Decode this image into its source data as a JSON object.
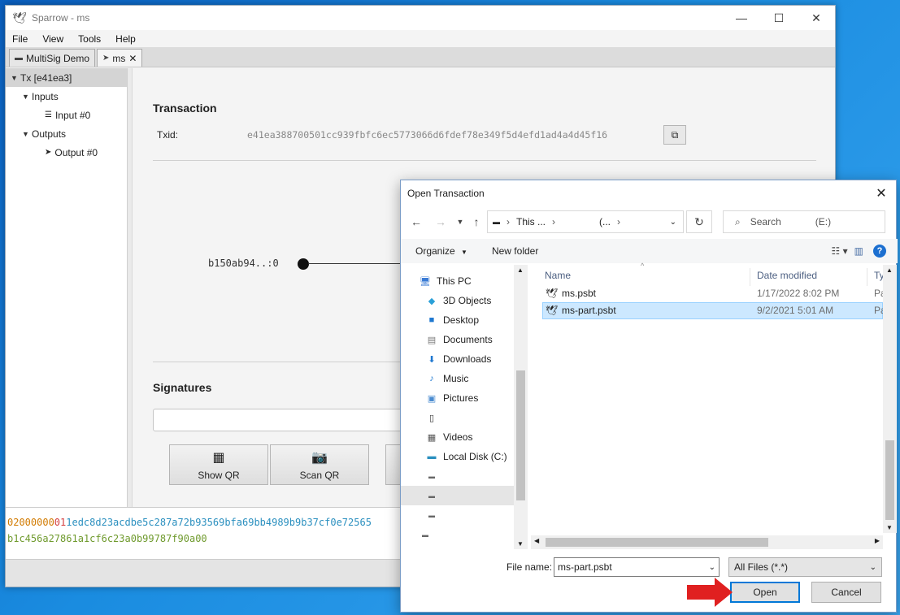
{
  "sparrow": {
    "title": "Sparrow - ms",
    "menu": [
      "File",
      "View",
      "Tools",
      "Help"
    ],
    "tabs": [
      {
        "label": "MultiSig Demo"
      },
      {
        "label": "ms"
      }
    ],
    "tree": {
      "root": "Tx [e41ea3]",
      "inputs": "Inputs",
      "input0": "Input #0",
      "outputs": "Outputs",
      "output0": "Output #0"
    },
    "transaction": {
      "heading": "Transaction",
      "txid_label": "Txid:",
      "txid_value": "e41ea388700501cc939fbfc6ec5773066d6fdef78e349f5d4efd1ad4a4d45f16",
      "input_label": "b150ab94..:0"
    },
    "signatures": {
      "heading": "Signatures"
    },
    "buttons": {
      "show_qr": "Show QR",
      "scan_qr": "Scan QR"
    },
    "hex": {
      "line1_a": "02000000",
      "line1_b": "01",
      "line1_c": "1edc8d23acdbe5c287a72b93569bfa69bb4989b9b37cf0e72565",
      "line2": "b1c456a27861a1cf6c23a0b99787f90a00"
    }
  },
  "dialog": {
    "title": "Open Transaction",
    "address": {
      "seg1": "This ...",
      "seg2": "(..."
    },
    "search_label": "Search",
    "search_scope": "(E:)",
    "organize": "Organize",
    "new_folder": "New folder",
    "nav_items": [
      "This PC",
      "3D Objects",
      "Desktop",
      "Documents",
      "Downloads",
      "Music",
      "Pictures",
      "",
      "Videos",
      "Local Disk (C:)",
      "",
      "",
      ""
    ],
    "columns": {
      "name": "Name",
      "date": "Date modified",
      "type": "Ty"
    },
    "files": [
      {
        "name": "ms.psbt",
        "date": "1/17/2022 8:02 PM",
        "type": "Pa"
      },
      {
        "name": "ms-part.psbt",
        "date": "9/2/2021 5:01 AM",
        "type": "Pa"
      }
    ],
    "file_name_label": "File name:",
    "file_name_value": "ms-part.psbt",
    "filter": "All Files (*.*)",
    "open": "Open",
    "cancel": "Cancel"
  },
  "colors": {
    "hex_version": "#d17a00",
    "hex_count": "#d43c3c",
    "hex_input": "#2a8fbf",
    "hex_tail": "#6f9a2d",
    "selection": "#cce8ff",
    "primary_border": "#0078d7",
    "arrow": "#e02020"
  }
}
